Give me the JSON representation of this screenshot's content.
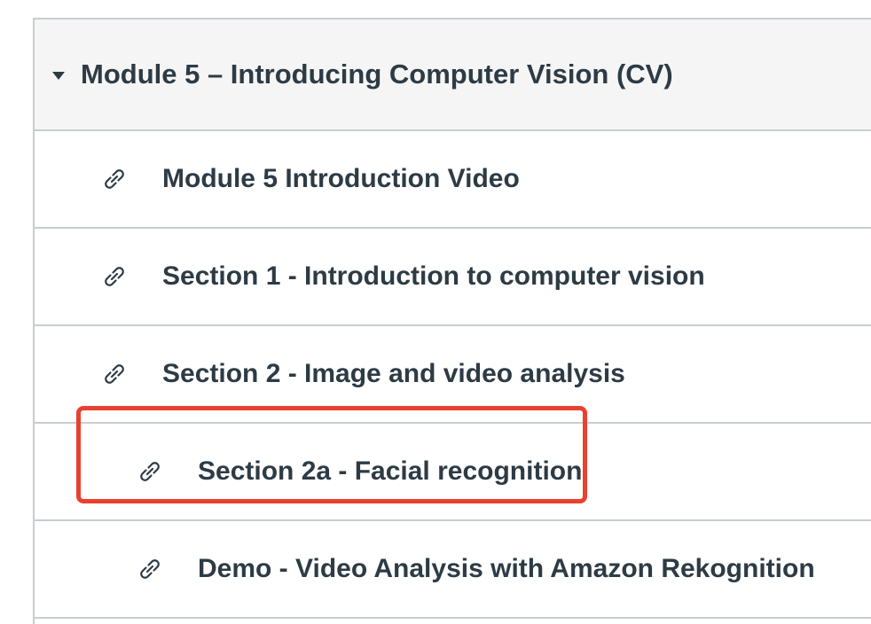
{
  "module": {
    "title": "Module 5 – Introducing Computer Vision (CV)",
    "caret_icon": "caret-down-icon"
  },
  "items": [
    {
      "title": "Module 5 Introduction Video",
      "icon": "link-icon"
    },
    {
      "title": "Section 1 - Introduction to computer vision",
      "icon": "link-icon"
    },
    {
      "title": "Section 2 - Image and video analysis",
      "icon": "link-icon"
    },
    {
      "title": "Section 2a - Facial recognition",
      "icon": "link-icon"
    },
    {
      "title": "Demo - Video Analysis with Amazon Rekognition",
      "icon": "link-icon"
    }
  ],
  "colors": {
    "text": "#2d3b45",
    "border": "#c7cdd1",
    "header_bg": "#f5f5f5",
    "highlight": "#e8412f"
  }
}
